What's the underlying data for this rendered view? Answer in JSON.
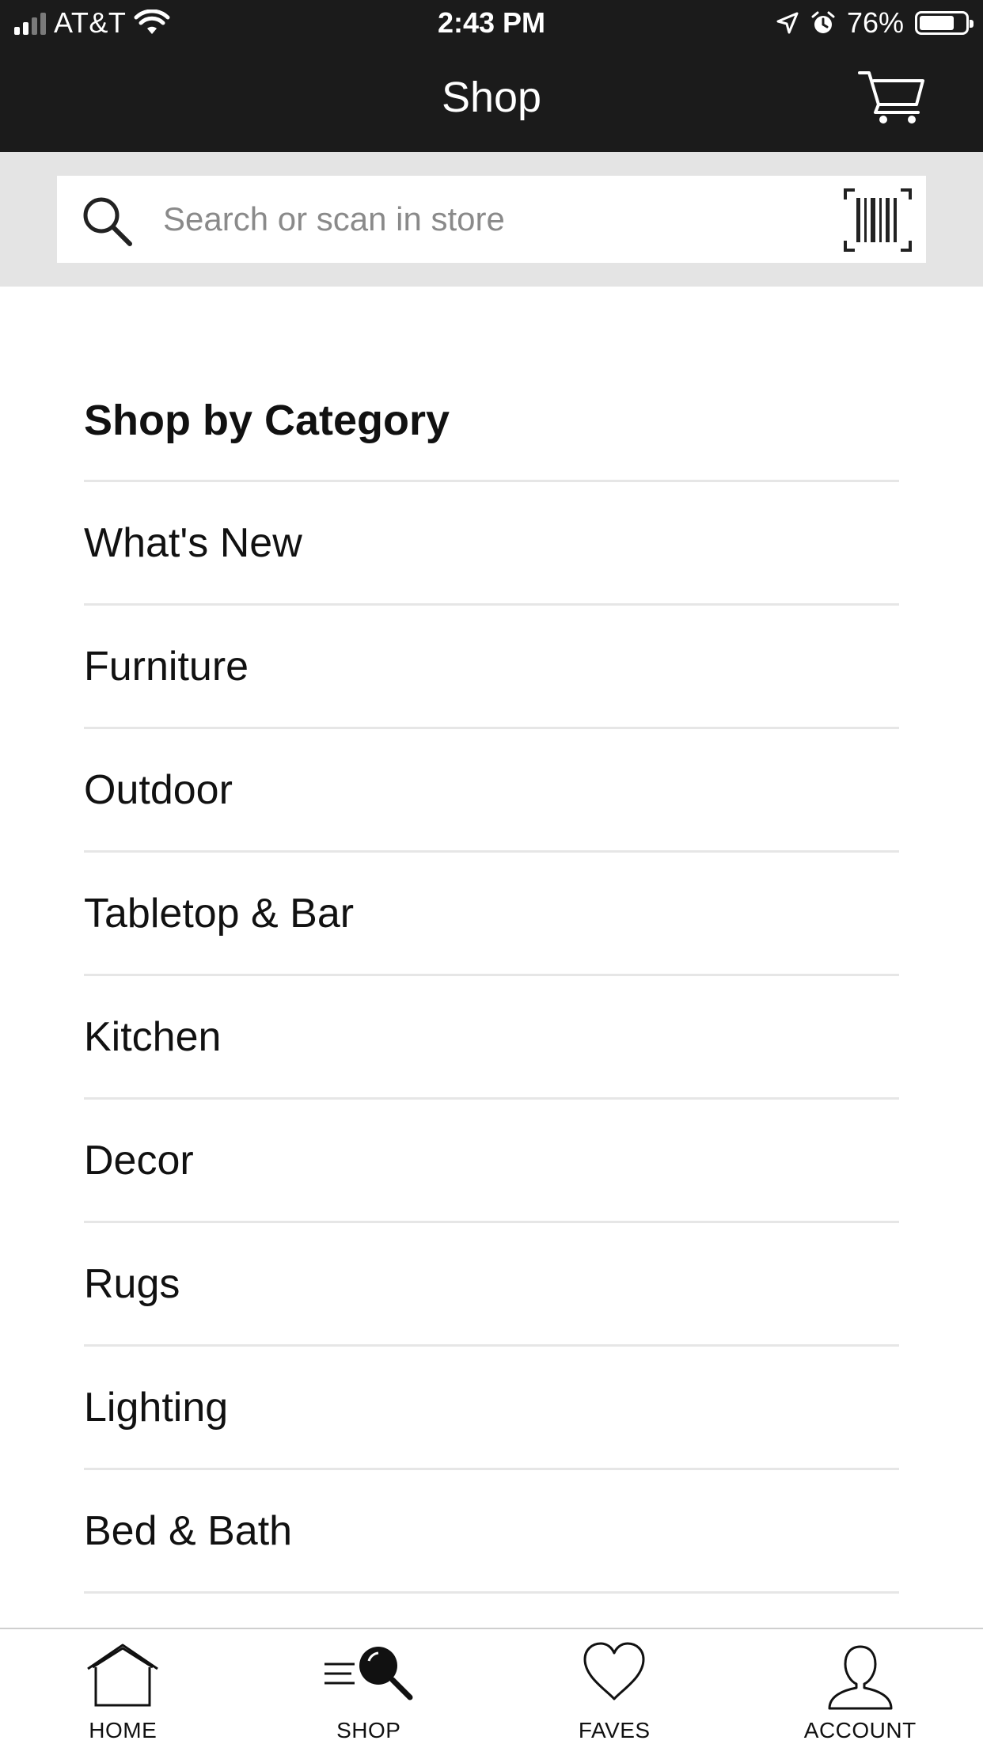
{
  "status_bar": {
    "carrier": "AT&T",
    "time": "2:43 PM",
    "battery_text": "76%",
    "battery_level": 0.76
  },
  "nav": {
    "title": "Shop",
    "cart_icon": "cart-icon"
  },
  "search": {
    "placeholder": "Search or scan in store",
    "value": "",
    "search_icon": "search-icon",
    "scan_icon": "barcode-icon"
  },
  "category": {
    "title": "Shop by Category",
    "items": [
      "What's New",
      "Furniture",
      "Outdoor",
      "Tabletop & Bar",
      "Kitchen",
      "Decor",
      "Rugs",
      "Lighting",
      "Bed & Bath"
    ]
  },
  "tabs": [
    {
      "label": "HOME",
      "icon": "home-icon"
    },
    {
      "label": "SHOP",
      "icon": "shop-search-icon"
    },
    {
      "label": "FAVES",
      "icon": "heart-icon"
    },
    {
      "label": "ACCOUNT",
      "icon": "user-icon"
    }
  ],
  "colors": {
    "header_bg": "#1b1b1b",
    "search_band_bg": "#e4e4e4",
    "divider": "#e6e6e6"
  }
}
